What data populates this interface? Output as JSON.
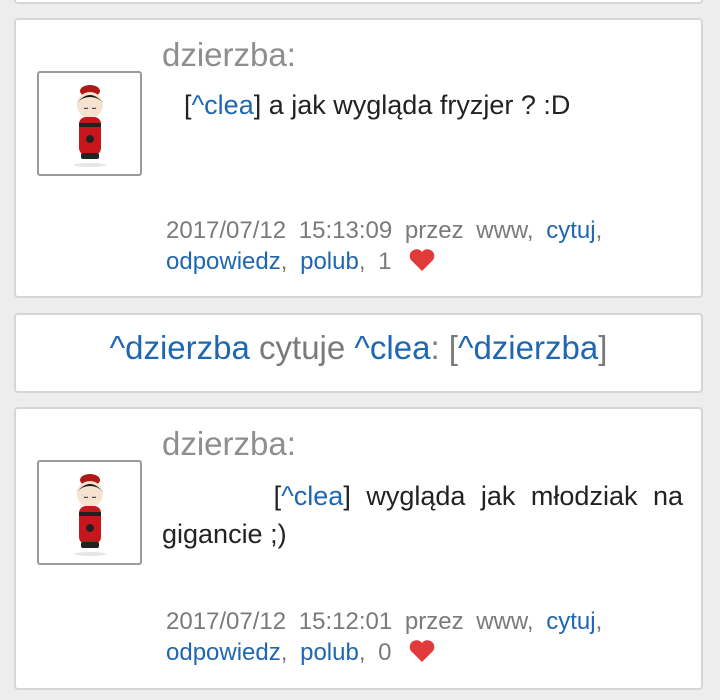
{
  "posts": [
    {
      "author": "dzierzba:",
      "mention": "^clea",
      "text": " a jak wygląda fryzjer ? :D",
      "date": "2017/07/12",
      "time": "15:13:09",
      "by_label": "przez",
      "source": "www,",
      "quote_label": "cytuj",
      "reply_label": "odpowiedz",
      "like_label": "polub",
      "like_count": "1"
    },
    {
      "author": "dzierzba:",
      "mention": "^clea",
      "text_line1": " wygląda jak młodziak na",
      "text_line2": "gigancie ;)",
      "date": "2017/07/12",
      "time": "15:12:01",
      "by_label": "przez",
      "source": "www,",
      "quote_label": "cytuj",
      "reply_label": "odpowiedz",
      "like_label": "polub",
      "like_count": "0"
    }
  ],
  "quote_bar": {
    "user": "^dzierzba",
    "verb": "cytuje",
    "target": "^clea",
    "separator": ":",
    "ref": "^dzierzba"
  },
  "colors": {
    "link": "#1f66b3",
    "heart": "#e03a3a",
    "author": "#8e8e8e"
  },
  "icons": {
    "heart": "heart-icon",
    "avatar": "kokeshi-doll-avatar"
  }
}
